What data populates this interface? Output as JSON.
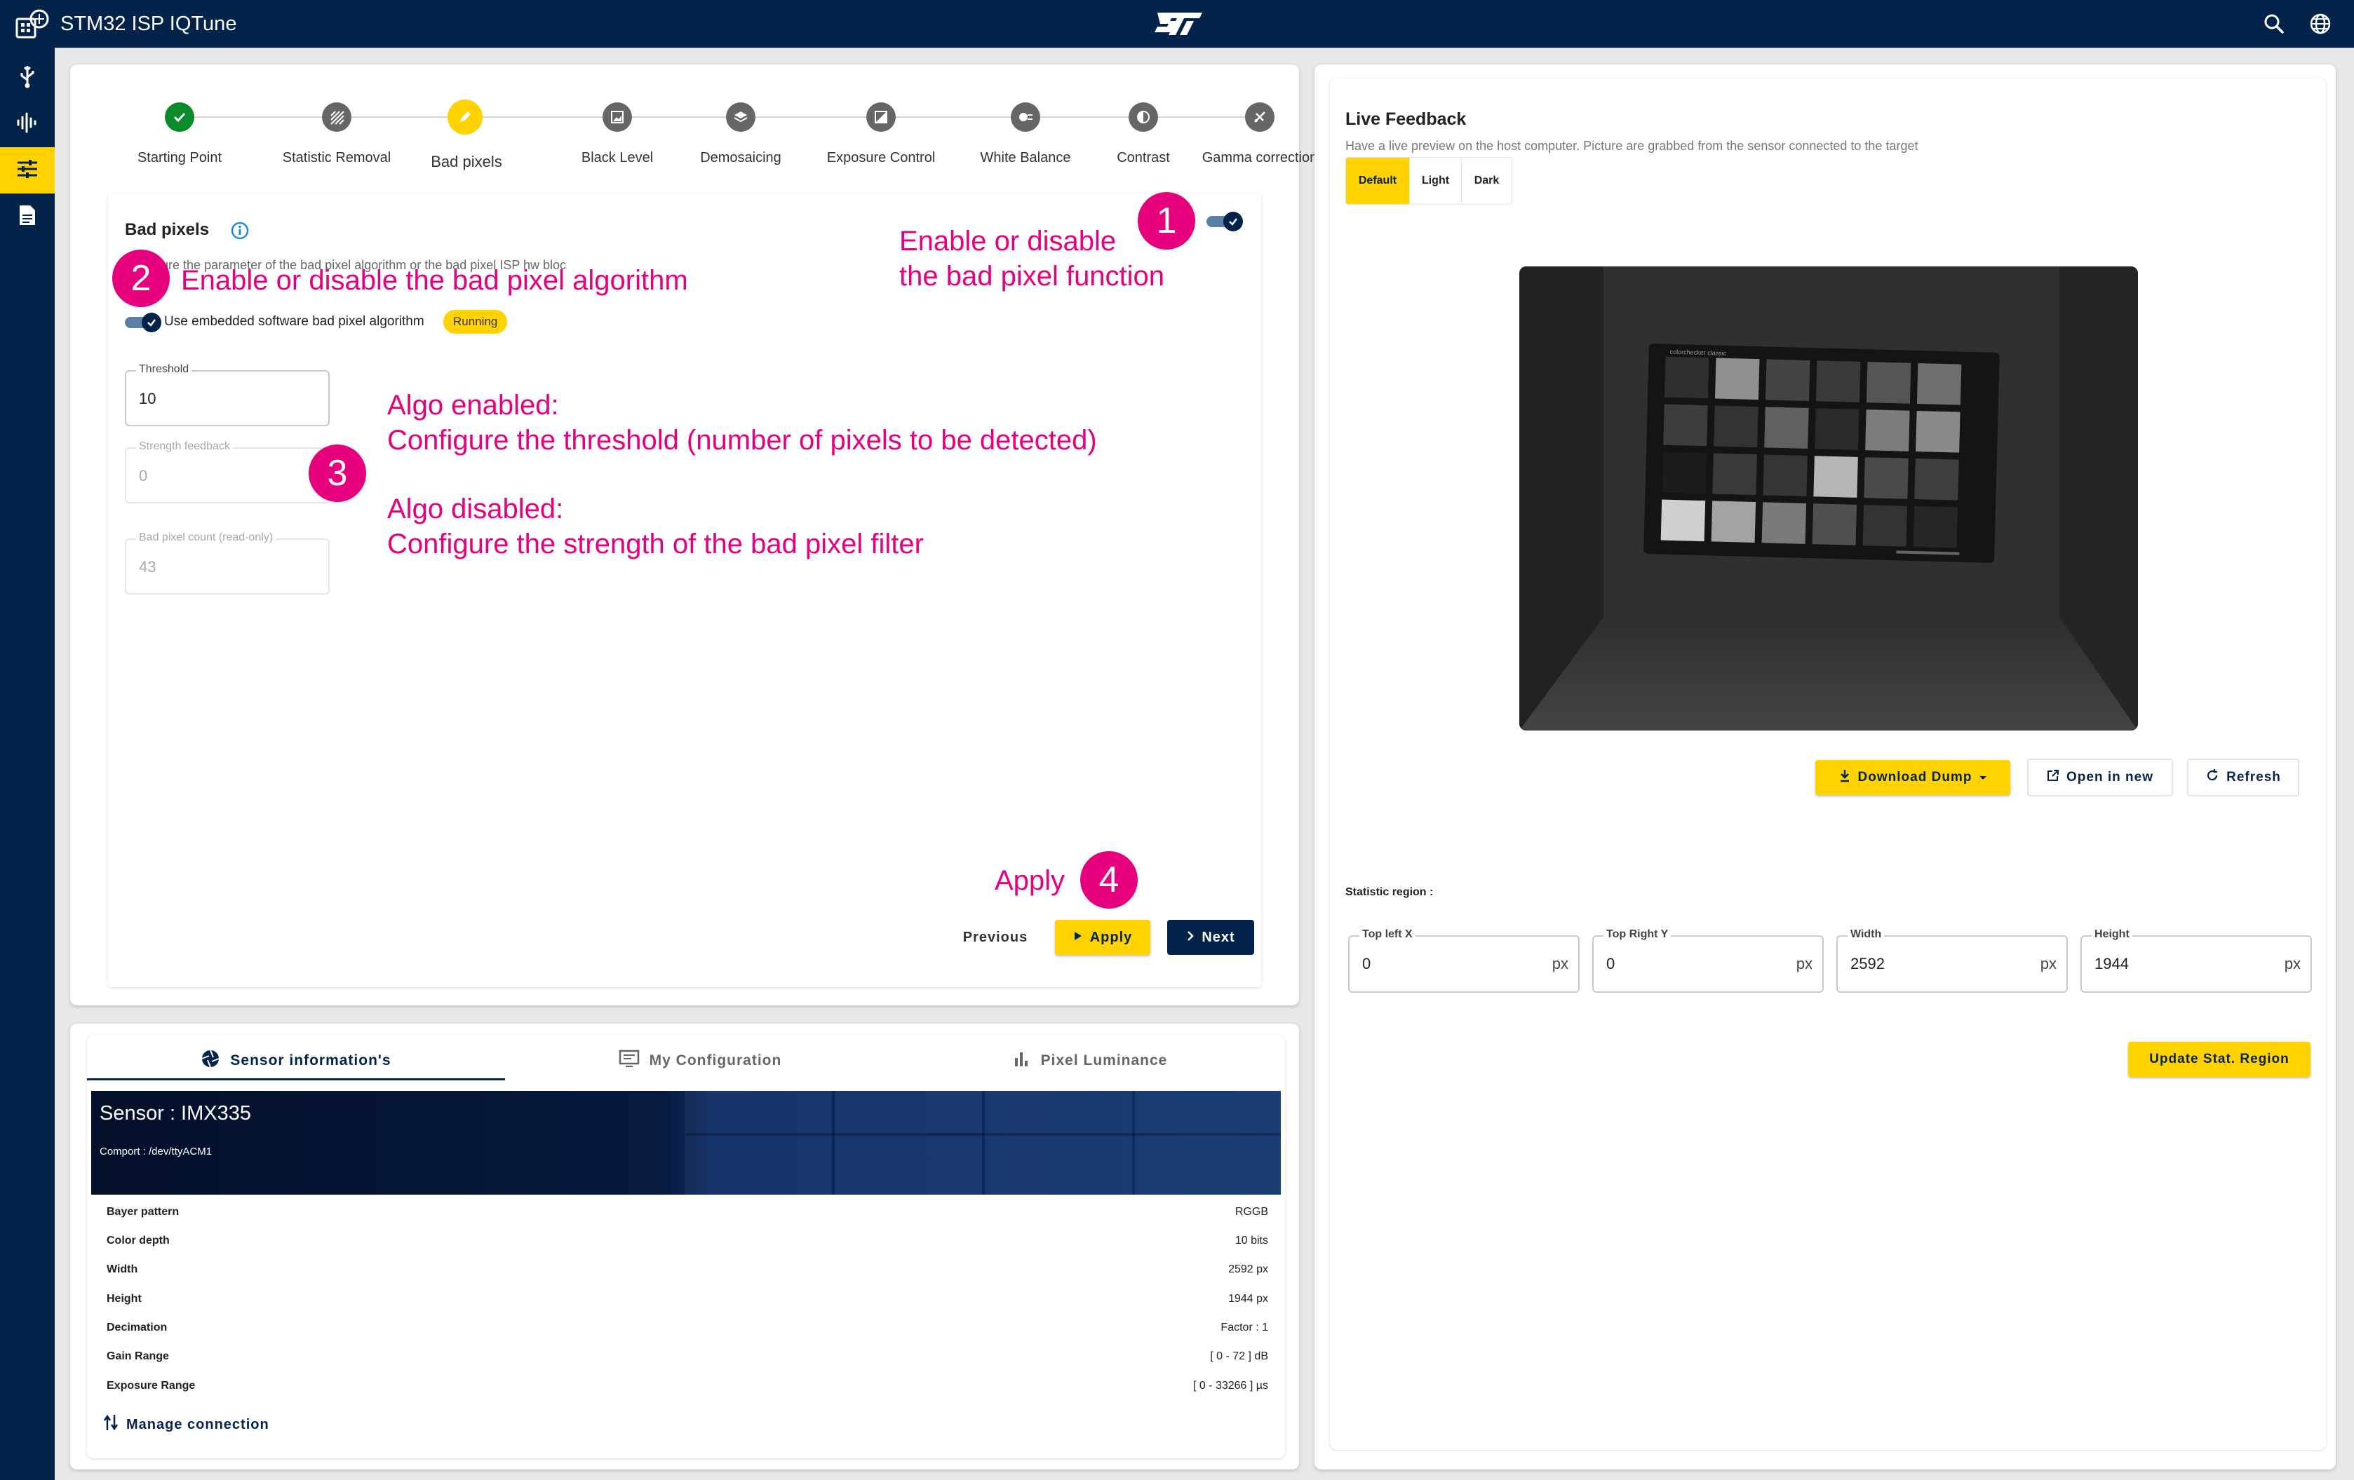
{
  "app": {
    "title": "STM32 ISP IQTune",
    "brand_color": "#03234b",
    "accent_color": "#ffd200"
  },
  "topbar_icons": [
    "search-icon",
    "globe-icon"
  ],
  "sidebar": {
    "items": [
      {
        "icon": "usb-icon",
        "active": false
      },
      {
        "icon": "waveform-icon",
        "active": false
      },
      {
        "icon": "tune-sliders-icon",
        "active": true
      },
      {
        "icon": "document-icon",
        "active": false
      }
    ]
  },
  "stepper": {
    "steps": [
      {
        "label": "Starting Point",
        "state": "done"
      },
      {
        "label": "Statistic Removal",
        "state": "todo"
      },
      {
        "label": "Bad pixels",
        "state": "active"
      },
      {
        "label": "Black Level",
        "state": "todo"
      },
      {
        "label": "Demosaicing",
        "state": "todo"
      },
      {
        "label": "Exposure Control",
        "state": "todo"
      },
      {
        "label": "White Balance",
        "state": "todo"
      },
      {
        "label": "Contrast",
        "state": "todo"
      },
      {
        "label": "Gamma correction",
        "state": "todo"
      }
    ]
  },
  "bad_pixels": {
    "title": "Bad pixels",
    "description": "Configure the parameter of the bad pixel algorithm or the bad pixel ISP hw bloc",
    "algo_toggle_label": "Use embedded software bad pixel algorithm",
    "status_badge": "Running",
    "threshold": {
      "label": "Threshold",
      "value": "10"
    },
    "strength": {
      "label": "Strength feedback",
      "value": "0"
    },
    "count": {
      "label": "Bad pixel count (read-only)",
      "value": "43"
    },
    "buttons": {
      "previous": "Previous",
      "apply": "Apply",
      "next": "Next"
    }
  },
  "annotations": {
    "badge1": "1",
    "text1_line1": "Enable or disable",
    "text1_line2": "the bad pixel function",
    "badge2": "2",
    "text2": "Enable or disable the bad pixel algorithm",
    "badge3": "3",
    "text3_line1": "Algo enabled:",
    "text3_line2": "Configure the threshold (number of pixels to be detected)",
    "text3_line3": "Algo disabled:",
    "text3_line4": "Configure the strength of the bad pixel filter",
    "badge4": "4",
    "text4": "Apply",
    "color": "#e6007e"
  },
  "sensor_tabs": {
    "tabs": [
      {
        "label": "Sensor information's",
        "icon": "aperture-icon",
        "active": true
      },
      {
        "label": "My Configuration",
        "icon": "monitor-icon",
        "active": false
      },
      {
        "label": "Pixel Luminance",
        "icon": "bar-chart-icon",
        "active": false
      }
    ]
  },
  "sensor": {
    "name": "Sensor : IMX335",
    "comport": "Comport : /dev/ttyACM1",
    "rows": [
      {
        "label": "Bayer pattern",
        "value": "RGGB"
      },
      {
        "label": "Color depth",
        "value": "10 bits"
      },
      {
        "label": "Width",
        "value": "2592 px"
      },
      {
        "label": "Height",
        "value": "1944 px"
      },
      {
        "label": "Decimation",
        "value": "Factor : 1"
      },
      {
        "label": "Gain Range",
        "value": "[ 0 - 72 ] dB"
      },
      {
        "label": "Exposure Range",
        "value": "[ 0 - 33266 ] µs"
      }
    ],
    "manage_connection": "Manage connection"
  },
  "live_feedback": {
    "title": "Live Feedback",
    "description": "Have a live preview on the host computer. Picture are grabbed from the sensor connected to the target",
    "modes": [
      {
        "label": "Default",
        "active": true
      },
      {
        "label": "Light",
        "active": false
      },
      {
        "label": "Dark",
        "active": false
      }
    ],
    "chart_brand": "colorchecker classic",
    "buttons": {
      "download": "Download Dump",
      "open": "Open in new",
      "refresh": "Refresh"
    },
    "stat_region_label": "Statistic region :",
    "fields": [
      {
        "label": "Top left X",
        "value": "0",
        "suffix": "px"
      },
      {
        "label": "Top Right Y",
        "value": "0",
        "suffix": "px"
      },
      {
        "label": "Width",
        "value": "2592",
        "suffix": "px"
      },
      {
        "label": "Height",
        "value": "1944",
        "suffix": "px"
      }
    ],
    "update_button": "Update Stat. Region"
  }
}
